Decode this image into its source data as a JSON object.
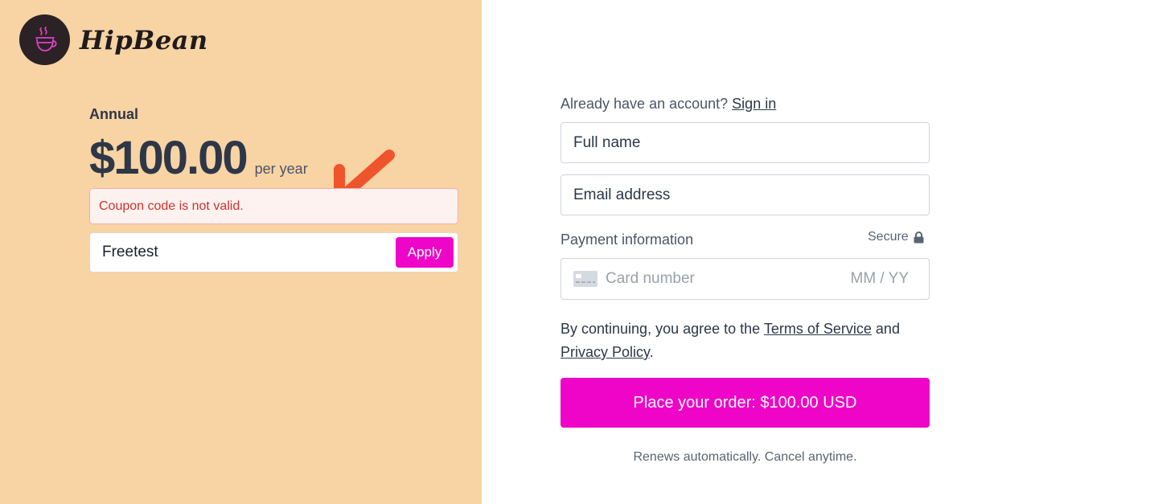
{
  "brand": {
    "name": "HipBean",
    "badge_color": "#2a2224",
    "icon_color": "#e040c8"
  },
  "plan": {
    "label": "Annual",
    "price": "$100.00",
    "period": "per year"
  },
  "coupon": {
    "error": "Coupon code is not valid.",
    "value": "Freetest",
    "apply_label": "Apply"
  },
  "account": {
    "prompt": "Already have an account?",
    "signin_label": "Sign in"
  },
  "form": {
    "full_name_placeholder": "Full name",
    "email_placeholder": "Email address",
    "payment_label": "Payment information",
    "secure_label": "Secure",
    "card_placeholder": "Card number",
    "expiry_placeholder": "MM / YY"
  },
  "terms": {
    "prefix": "By continuing, you agree to the",
    "tos_label": "Terms of Service",
    "and": "and",
    "privacy_label": "Privacy Policy",
    "suffix": "."
  },
  "order": {
    "button_label": "Place your order: $100.00 USD",
    "footnote": "Renews automatically. Cancel anytime."
  },
  "colors": {
    "accent": "#ee05c8",
    "left_panel": "#f8d3a3",
    "error": "#d0312d",
    "arrow": "#f0542c"
  }
}
